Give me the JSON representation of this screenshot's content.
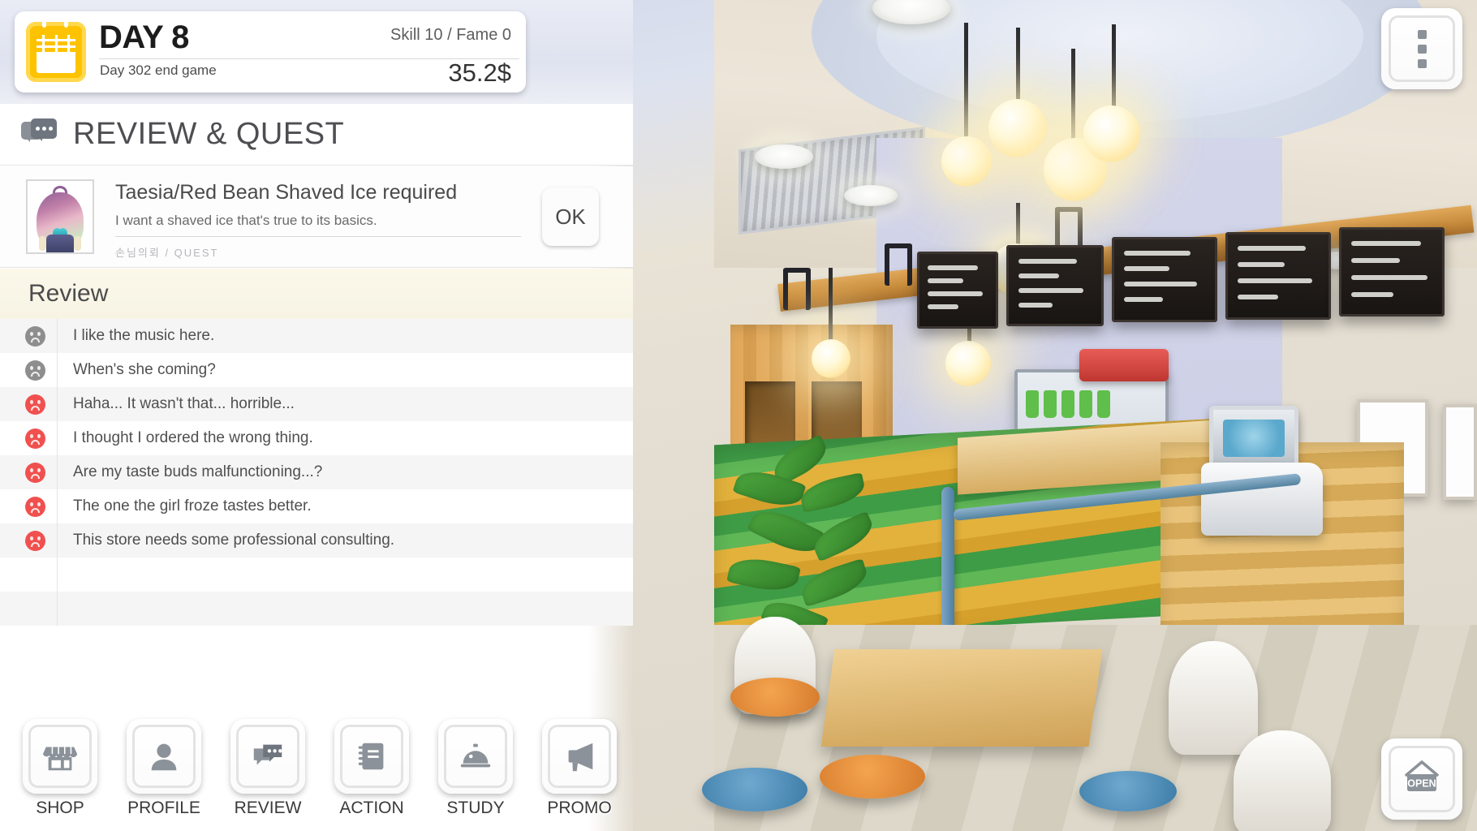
{
  "header": {
    "day_title": "DAY 8",
    "day_subtitle": "Day 302 end game",
    "stats": "Skill 10 / Fame 0",
    "money": "35.2$",
    "calendar_icon": "calendar-icon",
    "accent_color": "#fdc300"
  },
  "section": {
    "title": "REVIEW & QUEST",
    "icon": "chat-bubbles-icon"
  },
  "quest": {
    "portrait": "character-portrait-taesia",
    "title": "Taesia/Red Bean Shaved Ice required",
    "description": "I want a shaved ice that's true to its basics.",
    "meta": "손님의뢰 / QUEST",
    "ok_label": "OK"
  },
  "review": {
    "heading": "Review",
    "items": [
      {
        "mood": "neutral",
        "text": "I like the music here."
      },
      {
        "mood": "neutral",
        "text": "When's she coming?"
      },
      {
        "mood": "bad",
        "text": "Haha... It wasn't that... horrible..."
      },
      {
        "mood": "bad",
        "text": "I thought I ordered the wrong thing."
      },
      {
        "mood": "bad",
        "text": "Are my taste buds malfunctioning...?"
      },
      {
        "mood": "bad",
        "text": "The one the girl froze tastes better."
      },
      {
        "mood": "bad",
        "text": "This store needs some professional consulting."
      }
    ],
    "mood_colors": {
      "neutral": "#8e8e8e",
      "bad": "#f0514f"
    }
  },
  "nav": {
    "items": [
      {
        "label": "SHOP",
        "icon": "storefront-icon"
      },
      {
        "label": "PROFILE",
        "icon": "person-icon"
      },
      {
        "label": "REVIEW",
        "icon": "chat-bubbles-icon"
      },
      {
        "label": "ACTION",
        "icon": "notebook-icon"
      },
      {
        "label": "STUDY",
        "icon": "cloche-icon"
      },
      {
        "label": "PROMO",
        "icon": "megaphone-icon"
      }
    ]
  },
  "corner": {
    "menu_icon": "more-vertical-icon",
    "open_icon": "open-sign-icon",
    "open_label": "OPEN"
  }
}
